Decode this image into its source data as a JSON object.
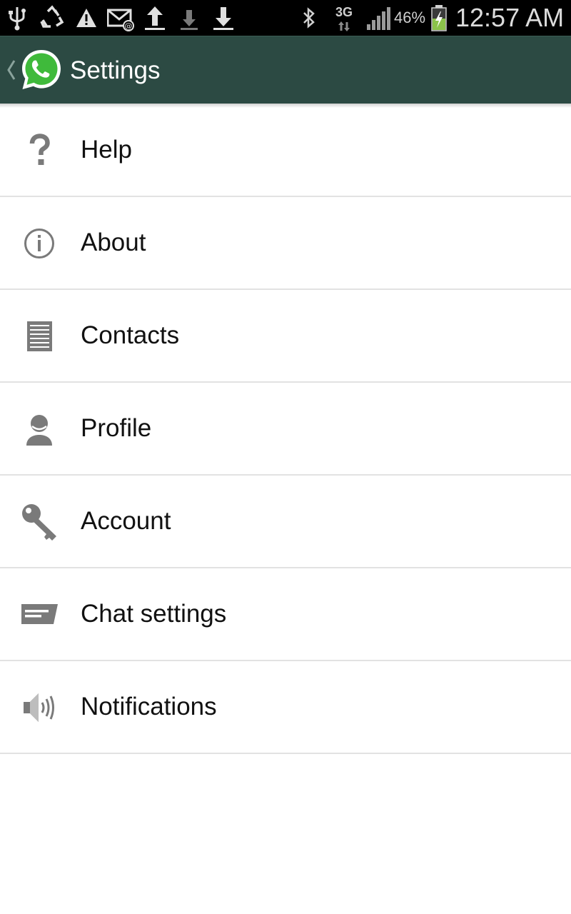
{
  "status_bar": {
    "network": "3G",
    "battery_percent": "46%",
    "time": "12:57 AM",
    "icons": [
      "usb-icon",
      "recycle-icon",
      "warning-icon",
      "email-icon",
      "upload-icon",
      "download-icon",
      "download-icon",
      "bluetooth-icon",
      "network-3g-icon",
      "signal-icon",
      "battery-charging-icon"
    ]
  },
  "app_bar": {
    "title": "Settings",
    "icons": [
      "back-chevron-icon",
      "whatsapp-logo"
    ],
    "color": "#2c4a43"
  },
  "menu": {
    "items": [
      {
        "label": "Help",
        "icon": "help-icon"
      },
      {
        "label": "About",
        "icon": "info-icon"
      },
      {
        "label": "Contacts",
        "icon": "contacts-icon"
      },
      {
        "label": "Profile",
        "icon": "profile-icon"
      },
      {
        "label": "Account",
        "icon": "key-icon"
      },
      {
        "label": "Chat settings",
        "icon": "chat-icon"
      },
      {
        "label": "Notifications",
        "icon": "speaker-icon"
      }
    ],
    "icon_color": "#7a7a7a"
  }
}
